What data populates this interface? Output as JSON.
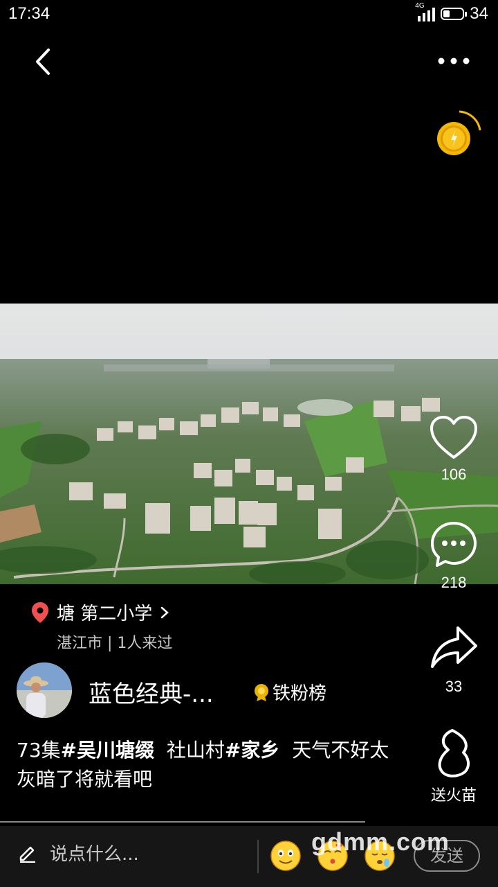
{
  "status_bar": {
    "time": "17:34",
    "network": "4G",
    "battery": "34",
    "battery_level": 0.34
  },
  "top_bar": {
    "back_icon": "chevron-left-icon",
    "more_icon": "more-dots-icon"
  },
  "reward": {
    "icon": "gold-coin-icon",
    "accent": "#f5b800"
  },
  "actions": {
    "like_count": "106",
    "comment_count": "218",
    "share_count": "33",
    "fire_label": "送火苗"
  },
  "location": {
    "name": "塘 第二小学",
    "sub": "湛江市 | 1人来过",
    "pin_color": "#f05050"
  },
  "author": {
    "name": "蓝色经典-...",
    "badge_label": "铁粉榜"
  },
  "caption": {
    "part1": "73集",
    "tag1": "#吴川塘缀",
    "part2": "  社山村",
    "tag2": "#家乡",
    "part3": "  天气不好太灰暗了将就看吧"
  },
  "comment_bar": {
    "placeholder": "说点什么...",
    "send_label": "发送"
  },
  "watermark": "gdmm.com"
}
